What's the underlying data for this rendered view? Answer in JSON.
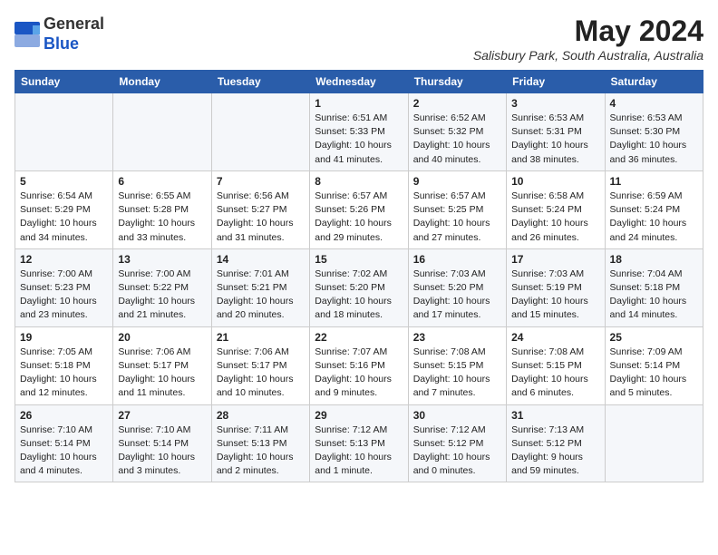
{
  "header": {
    "logo_general": "General",
    "logo_blue": "Blue",
    "month_title": "May 2024",
    "location": "Salisbury Park, South Australia, Australia"
  },
  "weekdays": [
    "Sunday",
    "Monday",
    "Tuesday",
    "Wednesday",
    "Thursday",
    "Friday",
    "Saturday"
  ],
  "weeks": [
    [
      {
        "day": "",
        "info": ""
      },
      {
        "day": "",
        "info": ""
      },
      {
        "day": "",
        "info": ""
      },
      {
        "day": "1",
        "info": "Sunrise: 6:51 AM\nSunset: 5:33 PM\nDaylight: 10 hours\nand 41 minutes."
      },
      {
        "day": "2",
        "info": "Sunrise: 6:52 AM\nSunset: 5:32 PM\nDaylight: 10 hours\nand 40 minutes."
      },
      {
        "day": "3",
        "info": "Sunrise: 6:53 AM\nSunset: 5:31 PM\nDaylight: 10 hours\nand 38 minutes."
      },
      {
        "day": "4",
        "info": "Sunrise: 6:53 AM\nSunset: 5:30 PM\nDaylight: 10 hours\nand 36 minutes."
      }
    ],
    [
      {
        "day": "5",
        "info": "Sunrise: 6:54 AM\nSunset: 5:29 PM\nDaylight: 10 hours\nand 34 minutes."
      },
      {
        "day": "6",
        "info": "Sunrise: 6:55 AM\nSunset: 5:28 PM\nDaylight: 10 hours\nand 33 minutes."
      },
      {
        "day": "7",
        "info": "Sunrise: 6:56 AM\nSunset: 5:27 PM\nDaylight: 10 hours\nand 31 minutes."
      },
      {
        "day": "8",
        "info": "Sunrise: 6:57 AM\nSunset: 5:26 PM\nDaylight: 10 hours\nand 29 minutes."
      },
      {
        "day": "9",
        "info": "Sunrise: 6:57 AM\nSunset: 5:25 PM\nDaylight: 10 hours\nand 27 minutes."
      },
      {
        "day": "10",
        "info": "Sunrise: 6:58 AM\nSunset: 5:24 PM\nDaylight: 10 hours\nand 26 minutes."
      },
      {
        "day": "11",
        "info": "Sunrise: 6:59 AM\nSunset: 5:24 PM\nDaylight: 10 hours\nand 24 minutes."
      }
    ],
    [
      {
        "day": "12",
        "info": "Sunrise: 7:00 AM\nSunset: 5:23 PM\nDaylight: 10 hours\nand 23 minutes."
      },
      {
        "day": "13",
        "info": "Sunrise: 7:00 AM\nSunset: 5:22 PM\nDaylight: 10 hours\nand 21 minutes."
      },
      {
        "day": "14",
        "info": "Sunrise: 7:01 AM\nSunset: 5:21 PM\nDaylight: 10 hours\nand 20 minutes."
      },
      {
        "day": "15",
        "info": "Sunrise: 7:02 AM\nSunset: 5:20 PM\nDaylight: 10 hours\nand 18 minutes."
      },
      {
        "day": "16",
        "info": "Sunrise: 7:03 AM\nSunset: 5:20 PM\nDaylight: 10 hours\nand 17 minutes."
      },
      {
        "day": "17",
        "info": "Sunrise: 7:03 AM\nSunset: 5:19 PM\nDaylight: 10 hours\nand 15 minutes."
      },
      {
        "day": "18",
        "info": "Sunrise: 7:04 AM\nSunset: 5:18 PM\nDaylight: 10 hours\nand 14 minutes."
      }
    ],
    [
      {
        "day": "19",
        "info": "Sunrise: 7:05 AM\nSunset: 5:18 PM\nDaylight: 10 hours\nand 12 minutes."
      },
      {
        "day": "20",
        "info": "Sunrise: 7:06 AM\nSunset: 5:17 PM\nDaylight: 10 hours\nand 11 minutes."
      },
      {
        "day": "21",
        "info": "Sunrise: 7:06 AM\nSunset: 5:17 PM\nDaylight: 10 hours\nand 10 minutes."
      },
      {
        "day": "22",
        "info": "Sunrise: 7:07 AM\nSunset: 5:16 PM\nDaylight: 10 hours\nand 9 minutes."
      },
      {
        "day": "23",
        "info": "Sunrise: 7:08 AM\nSunset: 5:15 PM\nDaylight: 10 hours\nand 7 minutes."
      },
      {
        "day": "24",
        "info": "Sunrise: 7:08 AM\nSunset: 5:15 PM\nDaylight: 10 hours\nand 6 minutes."
      },
      {
        "day": "25",
        "info": "Sunrise: 7:09 AM\nSunset: 5:14 PM\nDaylight: 10 hours\nand 5 minutes."
      }
    ],
    [
      {
        "day": "26",
        "info": "Sunrise: 7:10 AM\nSunset: 5:14 PM\nDaylight: 10 hours\nand 4 minutes."
      },
      {
        "day": "27",
        "info": "Sunrise: 7:10 AM\nSunset: 5:14 PM\nDaylight: 10 hours\nand 3 minutes."
      },
      {
        "day": "28",
        "info": "Sunrise: 7:11 AM\nSunset: 5:13 PM\nDaylight: 10 hours\nand 2 minutes."
      },
      {
        "day": "29",
        "info": "Sunrise: 7:12 AM\nSunset: 5:13 PM\nDaylight: 10 hours\nand 1 minute."
      },
      {
        "day": "30",
        "info": "Sunrise: 7:12 AM\nSunset: 5:12 PM\nDaylight: 10 hours\nand 0 minutes."
      },
      {
        "day": "31",
        "info": "Sunrise: 7:13 AM\nSunset: 5:12 PM\nDaylight: 9 hours\nand 59 minutes."
      },
      {
        "day": "",
        "info": ""
      }
    ]
  ]
}
